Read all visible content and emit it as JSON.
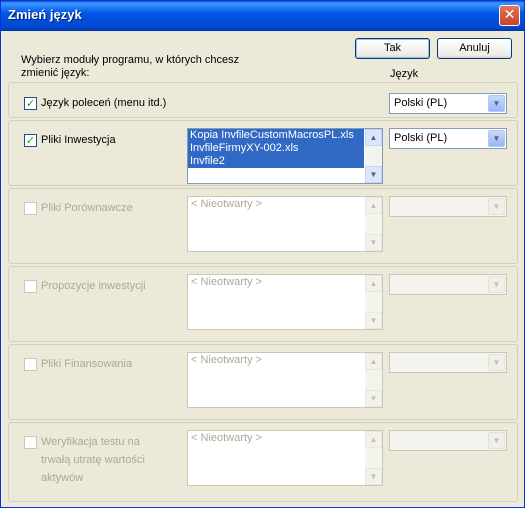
{
  "window": {
    "title": "Zmień język",
    "close_icon": "close-icon"
  },
  "buttons": {
    "ok": "Tak",
    "cancel": "Anuluj"
  },
  "instruction": [
    "Wybierz moduły programu, w których chcesz",
    "zmienić język:"
  ],
  "language_header": "Język",
  "commands": {
    "label": "Język poleceń (menu itd.)",
    "checked": true,
    "language": "Polski (PL)"
  },
  "modules": [
    {
      "label": [
        "Pliki Inwestycja"
      ],
      "checked": true,
      "enabled": true,
      "files": [
        "Kopia InvfileCustomMacrosPL.xls",
        "InvfileFirmyXY-002.xls",
        "Invfile2"
      ],
      "placeholder": "",
      "language": "Polski (PL)"
    },
    {
      "label": [
        "Pliki Porównawcze"
      ],
      "checked": false,
      "enabled": false,
      "files": [],
      "placeholder": "< Nieotwarty >",
      "language": ""
    },
    {
      "label": [
        "Propozycje inwestycji"
      ],
      "checked": false,
      "enabled": false,
      "files": [],
      "placeholder": "< Nieotwarty >",
      "language": ""
    },
    {
      "label": [
        "Pliki Finansowania"
      ],
      "checked": false,
      "enabled": false,
      "files": [],
      "placeholder": "< Nieotwarty >",
      "language": ""
    },
    {
      "label": [
        "Weryfikacja testu na",
        "trwałą utratę wartości",
        "aktywów"
      ],
      "checked": false,
      "enabled": false,
      "files": [],
      "placeholder": "< Nieotwarty >",
      "language": ""
    }
  ],
  "colors": {
    "title_bar": "#0058e6",
    "selection": "#316ac5",
    "dialog_bg": "#ece9d8"
  }
}
